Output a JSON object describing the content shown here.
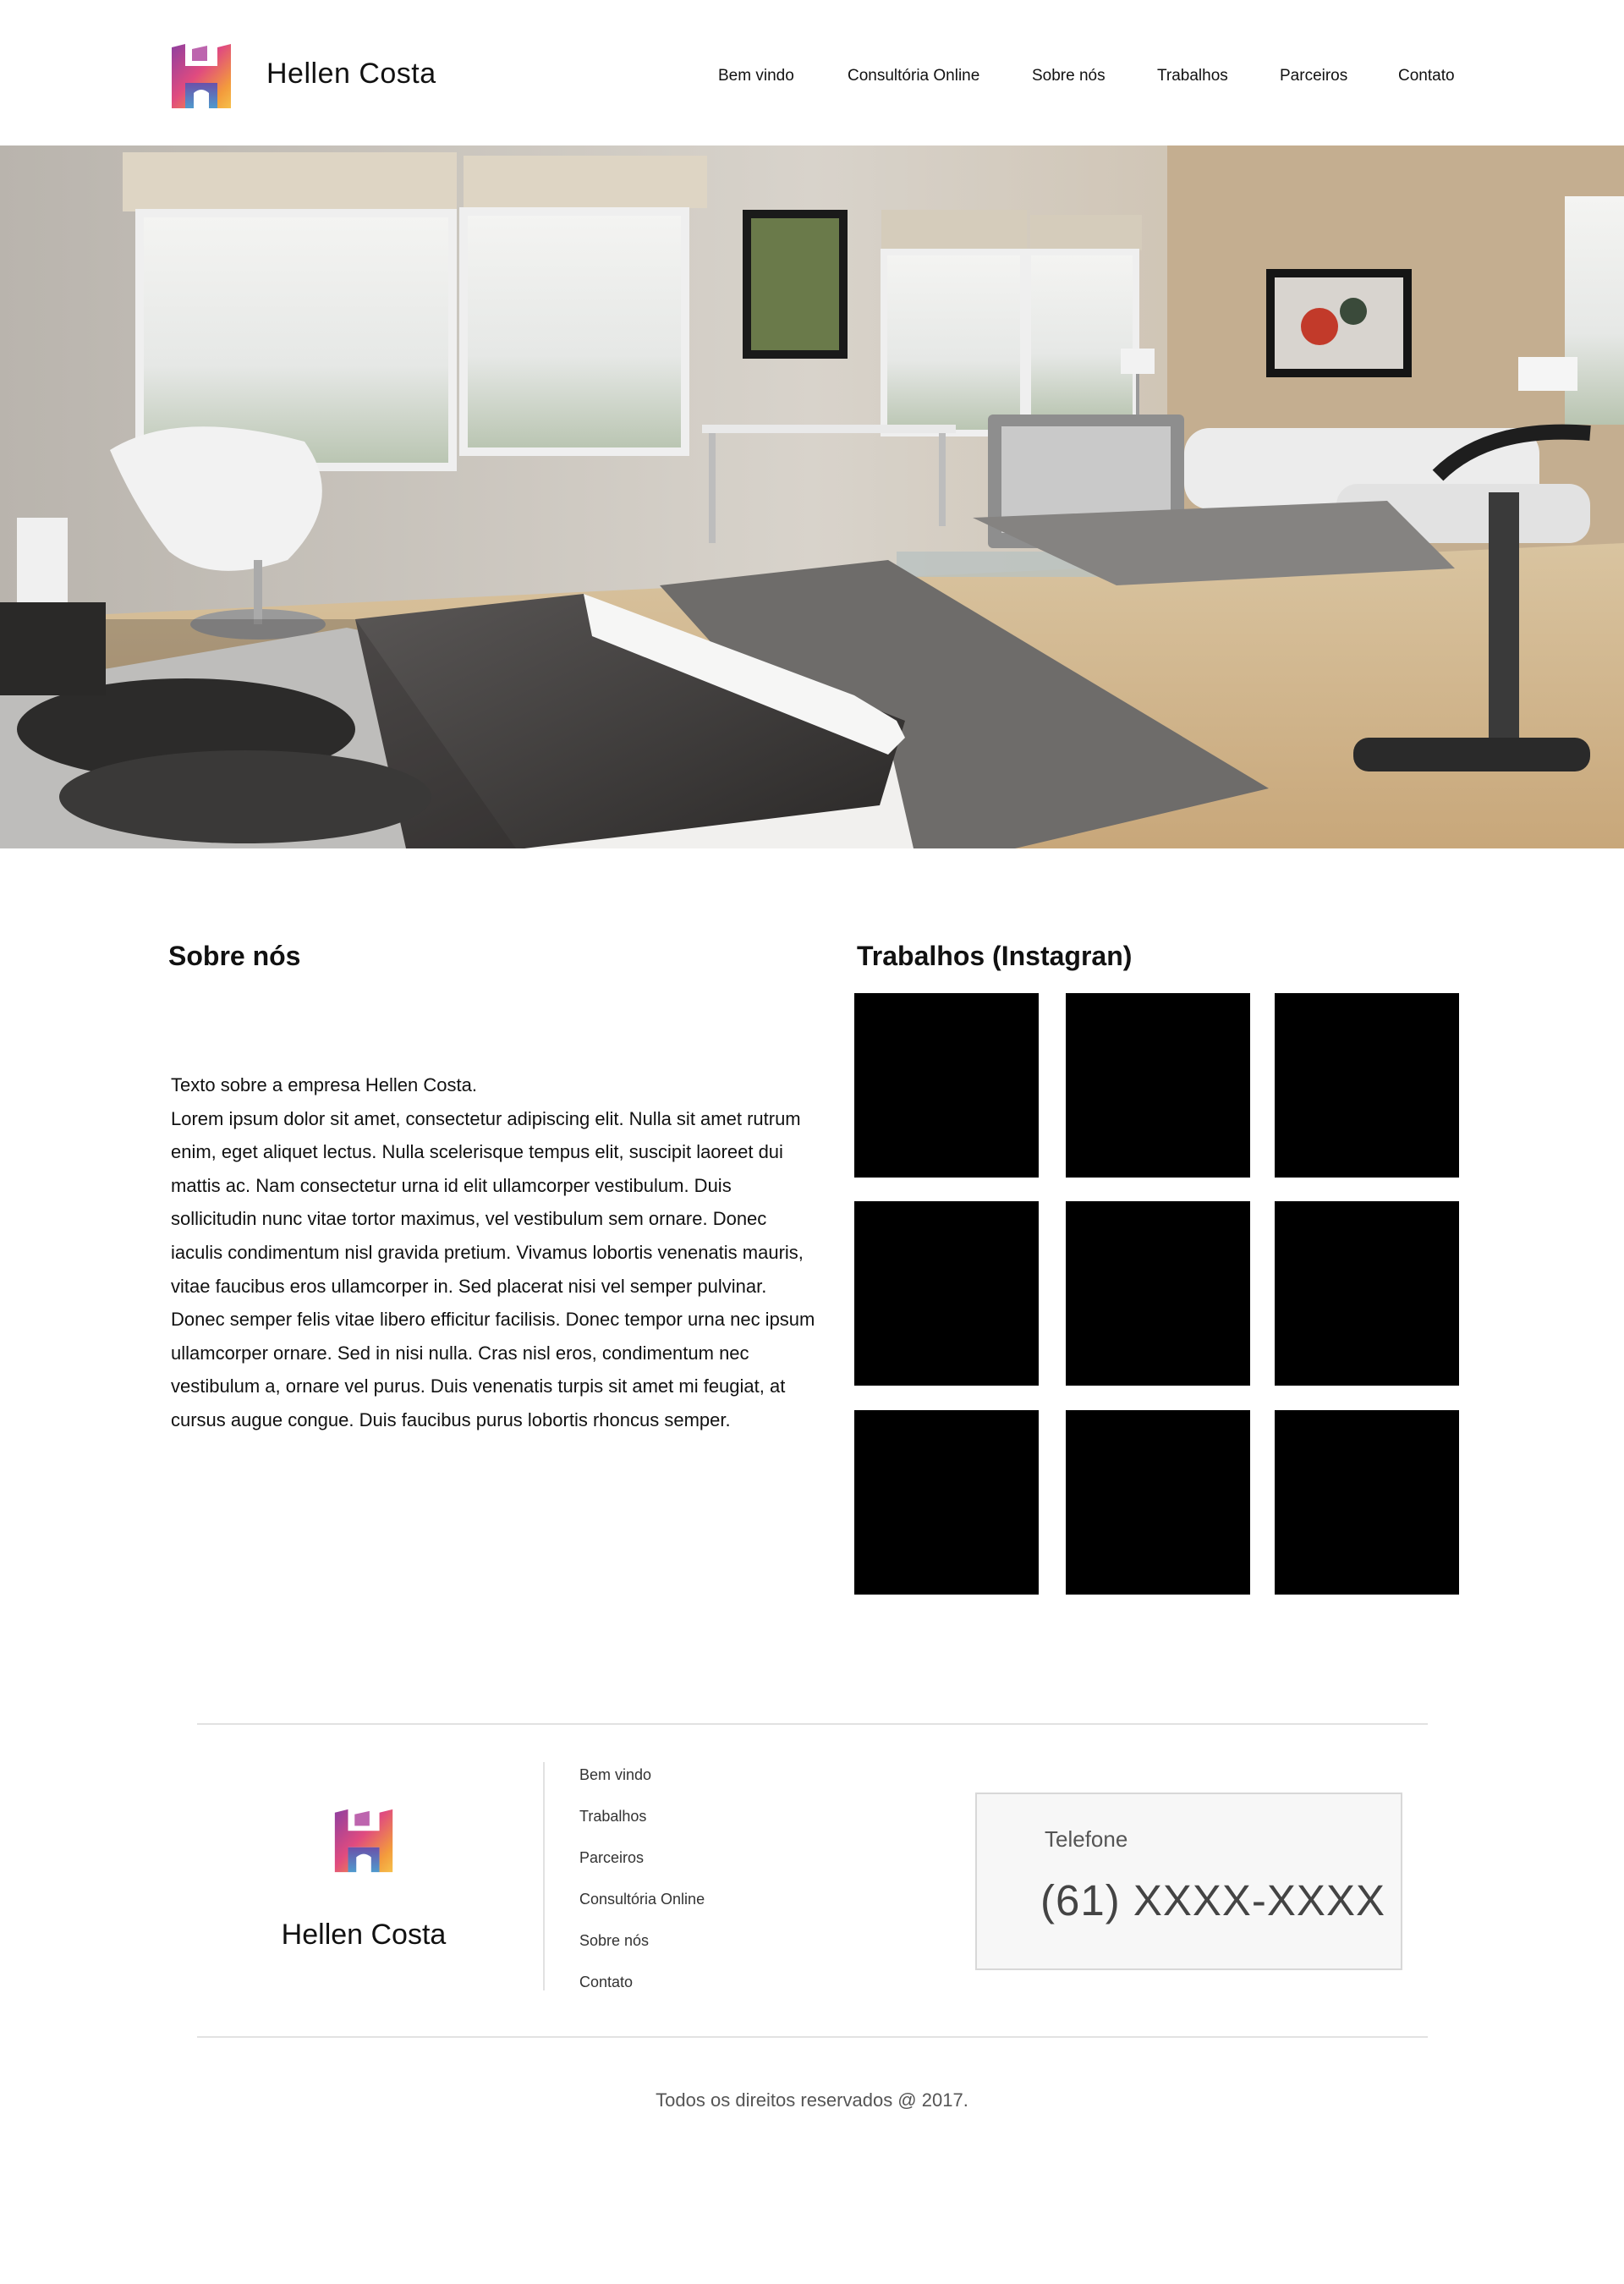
{
  "brand": {
    "name": "Hellen Costa",
    "logo_icon": "h-logo-icon",
    "logo_colors": [
      "#8e3fa0",
      "#e04b7f",
      "#f39b3c",
      "#3c6fb8"
    ]
  },
  "nav": {
    "items": [
      {
        "label": "Bem vindo"
      },
      {
        "label": "Consultória Online"
      },
      {
        "label": "Sobre nós"
      },
      {
        "label": "Trabalhos"
      },
      {
        "label": "Parceiros"
      },
      {
        "label": "Contato"
      }
    ]
  },
  "hero": {
    "image": "modern-bedroom-interior-photo"
  },
  "about": {
    "title": "Sobre nós",
    "intro": "Texto sobre a empresa Hellen Costa.",
    "body": "Lorem ipsum dolor sit amet, consectetur adipiscing elit. Nulla sit amet rutrum enim, eget aliquet lectus. Nulla scelerisque tempus elit, suscipit laoreet dui mattis ac. Nam consectetur urna id elit ullamcorper vestibulum. Duis sollicitudin nunc vitae tortor maximus, vel vestibulum sem ornare. Donec iaculis condimentum nisl gravida pretium. Vivamus lobortis venenatis mauris, vitae faucibus eros ullamcorper in. Sed placerat nisi vel semper pulvinar. Donec semper felis vitae libero efficitur facilisis. Donec tempor urna nec ipsum ullamcorper ornare. Sed in nisi nulla. Cras nisl eros, condimentum nec vestibulum a, ornare vel purus. Duis venenatis turpis sit amet mi feugiat, at cursus augue congue. Duis faucibus purus lobortis rhoncus semper."
  },
  "works": {
    "title": "Trabalhos (Instagran)",
    "tile_count": 9,
    "tile_color": "#000000"
  },
  "footer": {
    "brand": "Hellen Costa",
    "links": [
      {
        "label": "Bem vindo"
      },
      {
        "label": "Trabalhos"
      },
      {
        "label": "Parceiros"
      },
      {
        "label": "Consultória Online"
      },
      {
        "label": "Sobre nós"
      },
      {
        "label": "Contato"
      }
    ],
    "phone": {
      "label": "Telefone",
      "number": "(61) XXXX-XXXX"
    },
    "copyright": "Todos os direitos reservados @ 2017."
  }
}
